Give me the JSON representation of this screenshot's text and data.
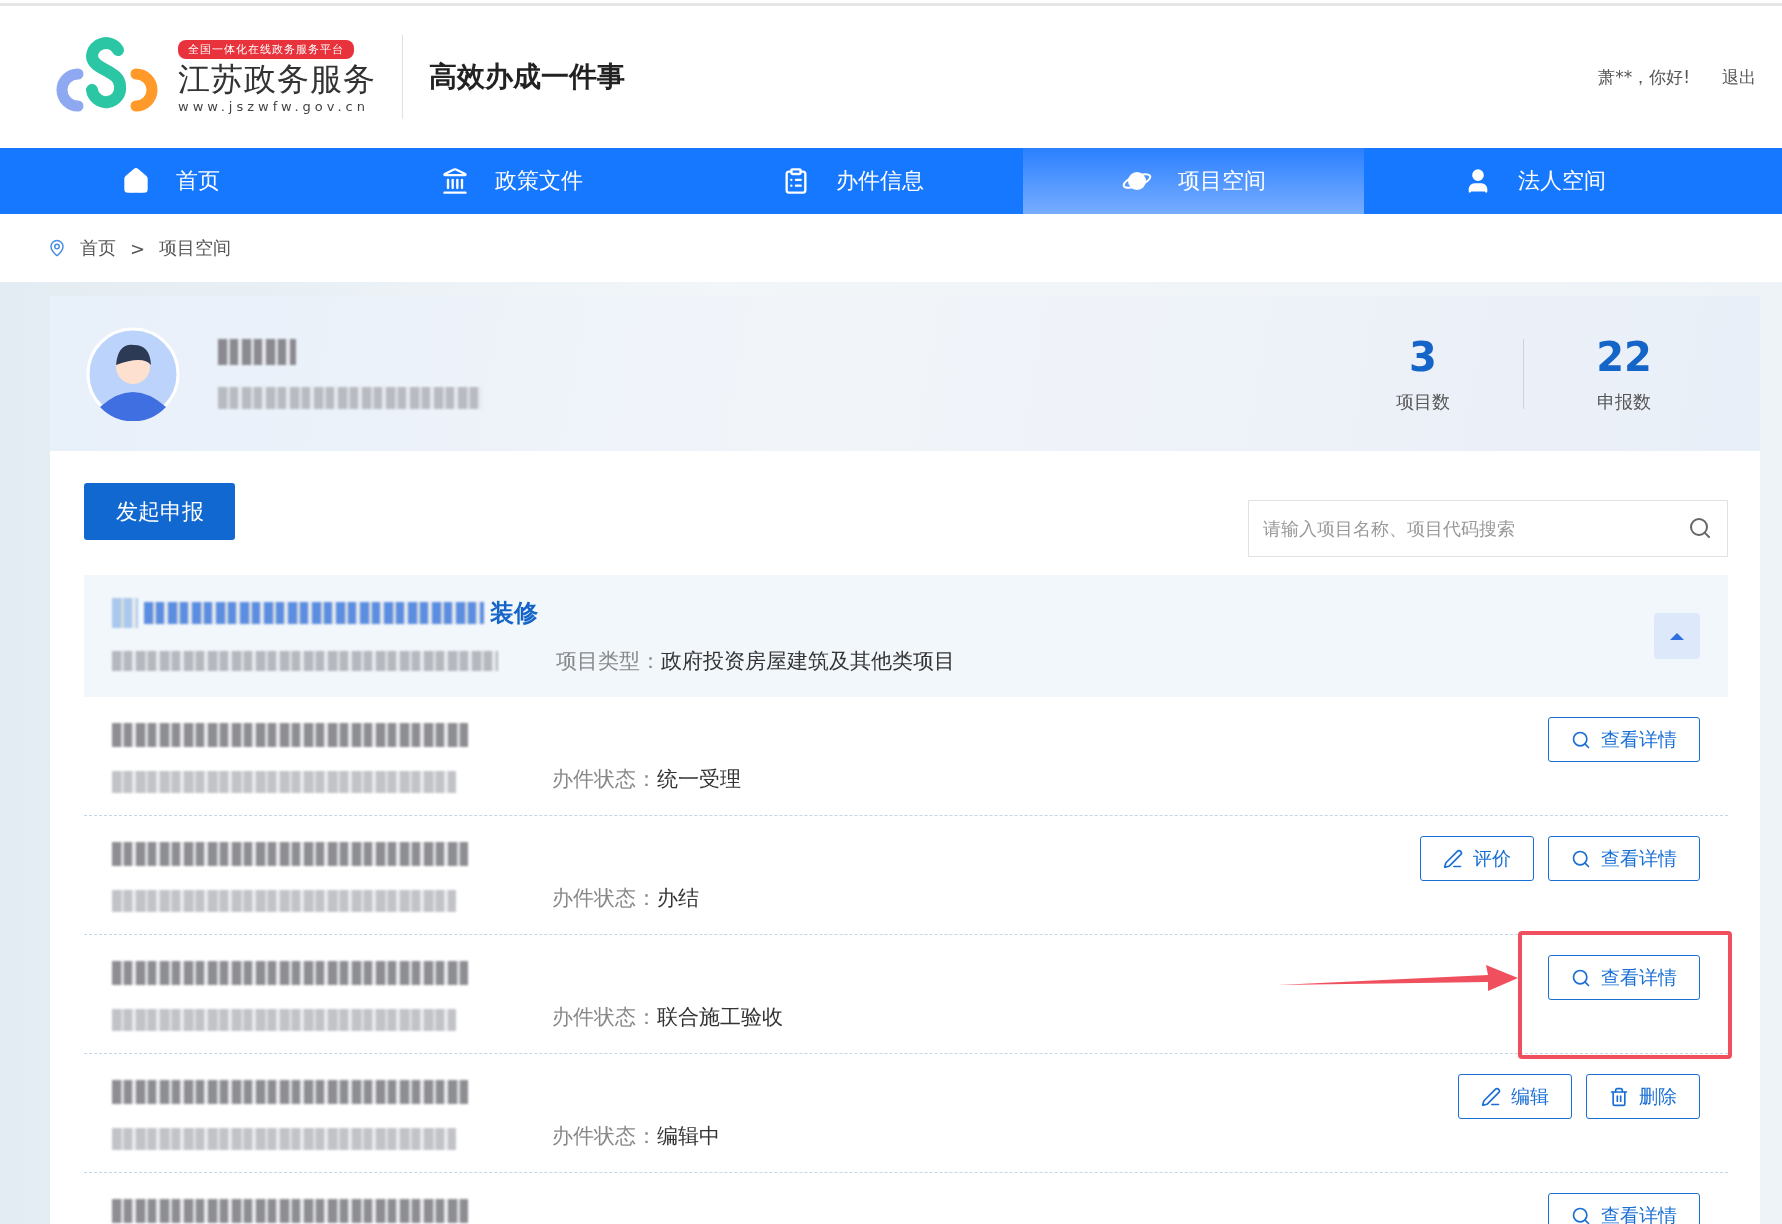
{
  "header": {
    "badge": "全国一体化在线政务服务平台",
    "site_name": "江苏政务服务",
    "site_url": "www.jszwfw.gov.cn",
    "slogan": "高效办成一件事",
    "greeting": "萧**，你好!",
    "logout": "退出"
  },
  "nav": [
    {
      "label": "首页",
      "selected": false
    },
    {
      "label": "政策文件",
      "selected": false
    },
    {
      "label": "办件信息",
      "selected": false
    },
    {
      "label": "项目空间",
      "selected": true
    },
    {
      "label": "法人空间",
      "selected": false
    }
  ],
  "breadcrumb": [
    "首页",
    ">",
    "项目空间"
  ],
  "profile": {
    "stats": [
      {
        "value": "3",
        "label": "项目数"
      },
      {
        "value": "22",
        "label": "申报数"
      }
    ]
  },
  "start_button": "发起申报",
  "search": {
    "placeholder": "请输入项目名称、项目代码搜索"
  },
  "project": {
    "title_tail": "装修",
    "type_label": "项目类型：",
    "type_value": "政府投资房屋建筑及其他类项目",
    "expanded": true
  },
  "rows": [
    {
      "status_label": "办件状态：",
      "status": "统一受理",
      "highlighted": false,
      "buttons": [
        {
          "kind": "view",
          "label": "查看详情"
        }
      ]
    },
    {
      "status_label": "办件状态：",
      "status": "办结",
      "highlighted": false,
      "buttons": [
        {
          "kind": "rate",
          "label": "评价"
        },
        {
          "kind": "view",
          "label": "查看详情"
        }
      ]
    },
    {
      "status_label": "办件状态：",
      "status": "联合施工验收",
      "highlighted": true,
      "buttons": [
        {
          "kind": "view",
          "label": "查看详情"
        }
      ]
    },
    {
      "status_label": "办件状态：",
      "status": "编辑中",
      "highlighted": false,
      "buttons": [
        {
          "kind": "edit",
          "label": "编辑"
        },
        {
          "kind": "delete",
          "label": "删除"
        }
      ]
    },
    {
      "highlighted": false,
      "buttons": [
        {
          "kind": "view",
          "label": "查看详情"
        }
      ]
    }
  ]
}
